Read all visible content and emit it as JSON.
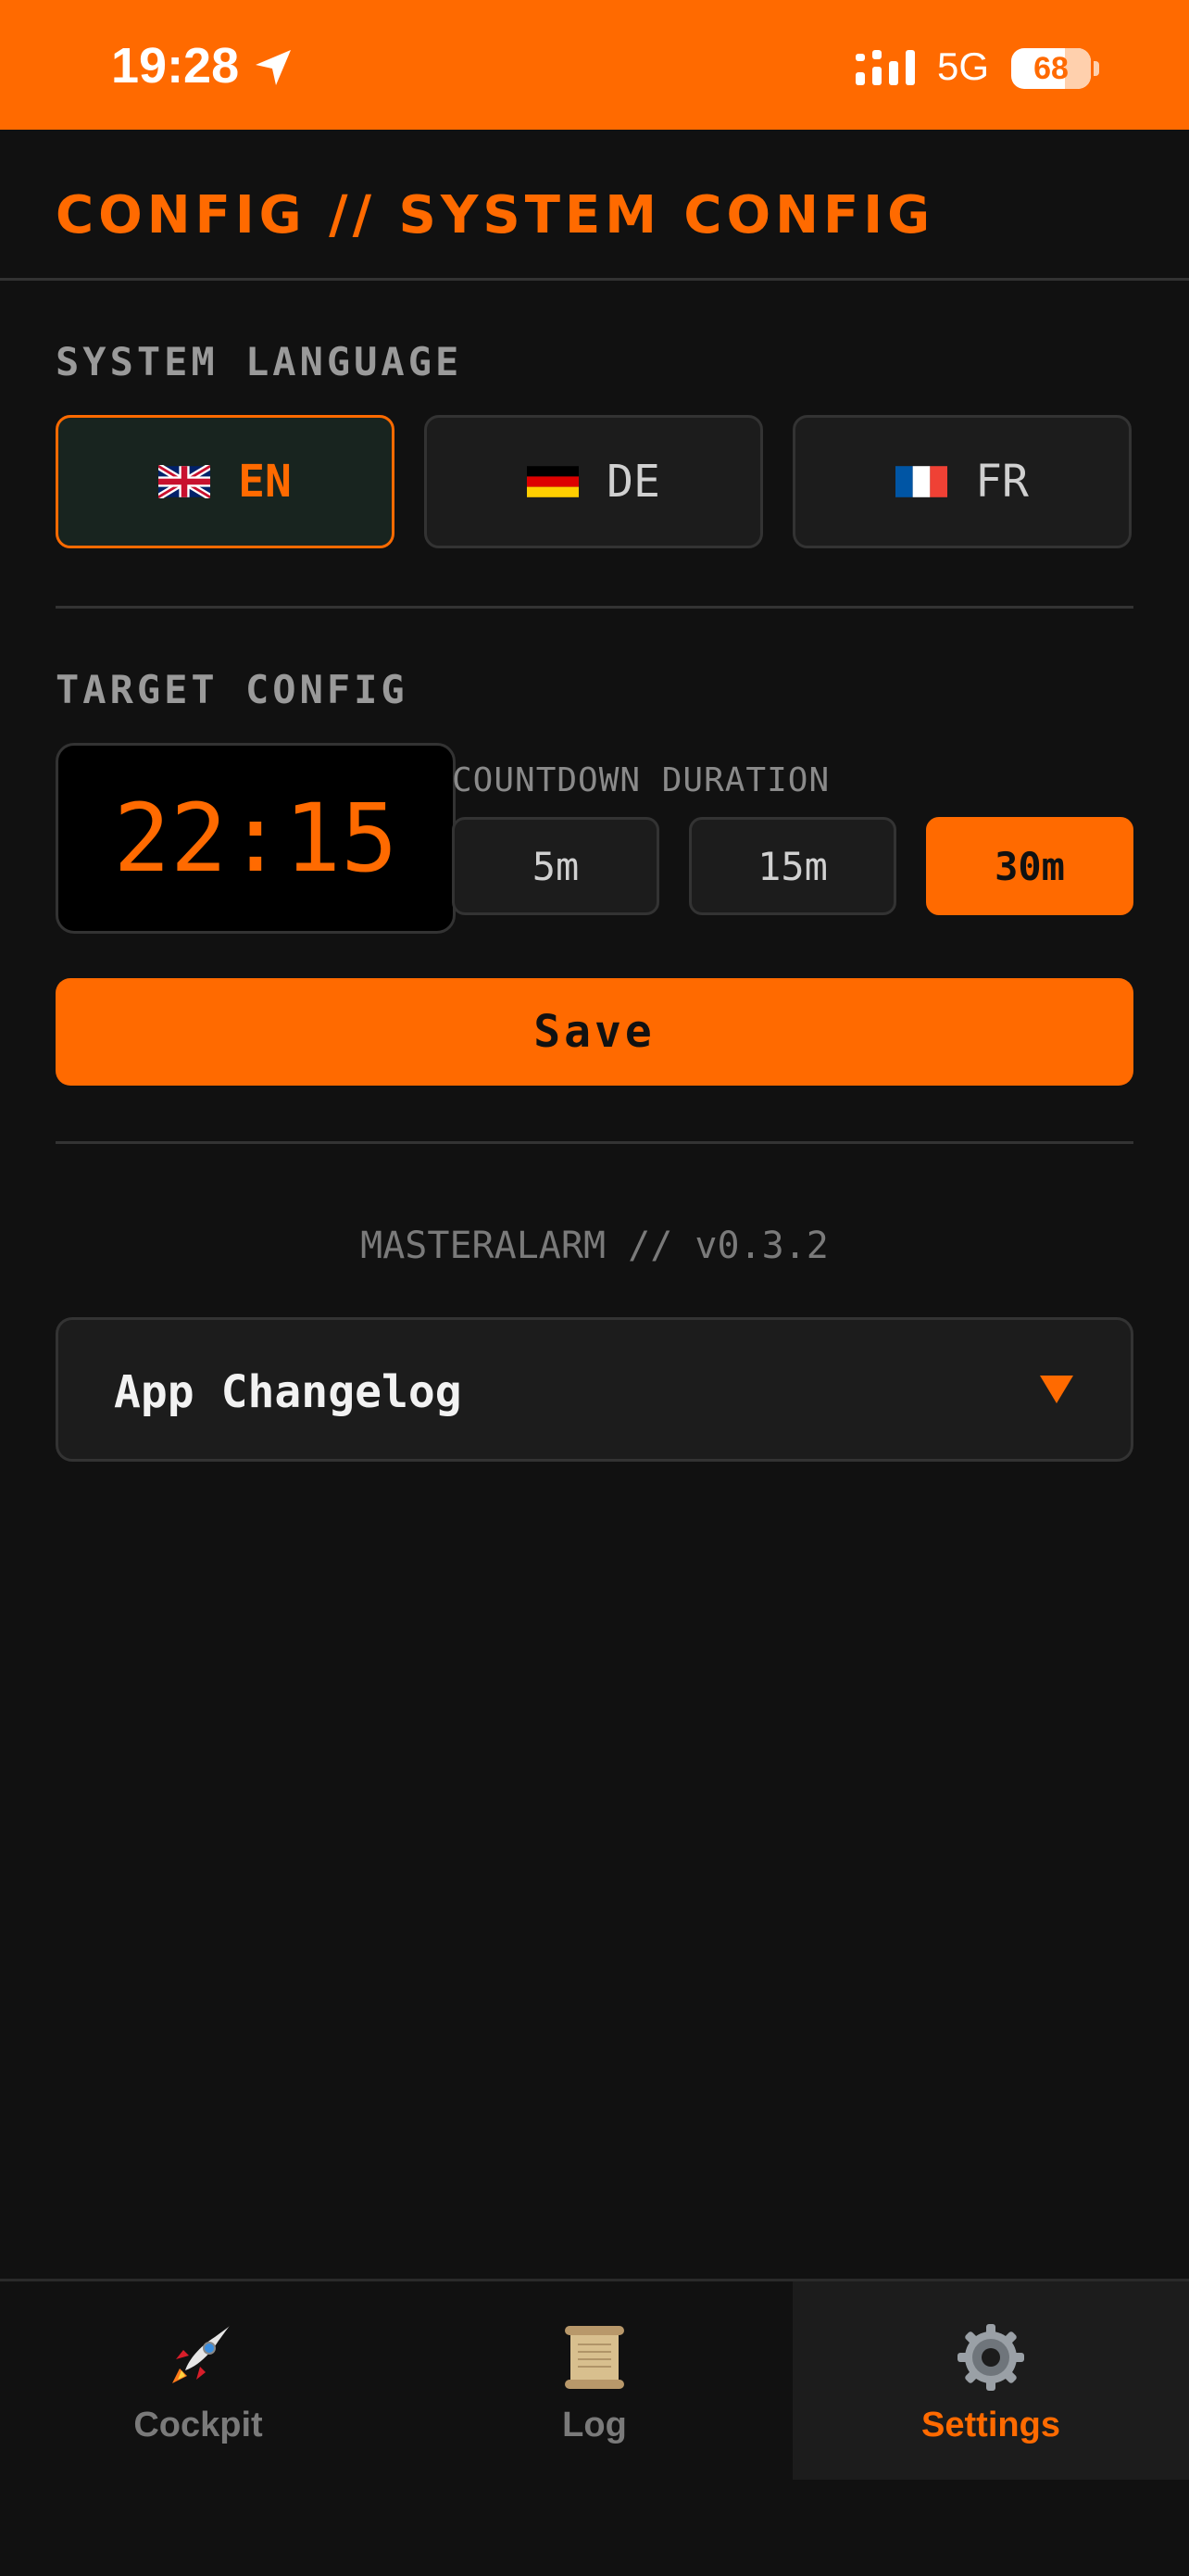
{
  "status_bar": {
    "time": "19:28",
    "network": "5G",
    "battery": "68"
  },
  "header": {
    "title": "CONFIG // SYSTEM CONFIG"
  },
  "language": {
    "label": "SYSTEM LANGUAGE",
    "options": [
      {
        "code": "EN",
        "flag": "uk-flag-icon",
        "selected": true
      },
      {
        "code": "DE",
        "flag": "germany-flag-icon",
        "selected": false
      },
      {
        "code": "FR",
        "flag": "france-flag-icon",
        "selected": false
      }
    ]
  },
  "target": {
    "label": "TARGET CONFIG",
    "time": "22:15",
    "countdown_label": "COUNTDOWN DURATION",
    "durations": [
      {
        "label": "5m",
        "selected": false
      },
      {
        "label": "15m",
        "selected": false
      },
      {
        "label": "30m",
        "selected": true
      }
    ],
    "save_label": "Save"
  },
  "version": "MASTERALARM // v0.3.2",
  "changelog": {
    "label": "App Changelog",
    "caret": "caret-down-icon"
  },
  "nav": [
    {
      "label": "Cockpit",
      "icon": "rocket-icon",
      "active": false
    },
    {
      "label": "Log",
      "icon": "scroll-icon",
      "active": false
    },
    {
      "label": "Settings",
      "icon": "gear-icon",
      "active": true
    }
  ],
  "colors": {
    "accent": "#ff6a00",
    "background": "#111111",
    "surface": "#1c1c1c",
    "border": "#333333"
  }
}
